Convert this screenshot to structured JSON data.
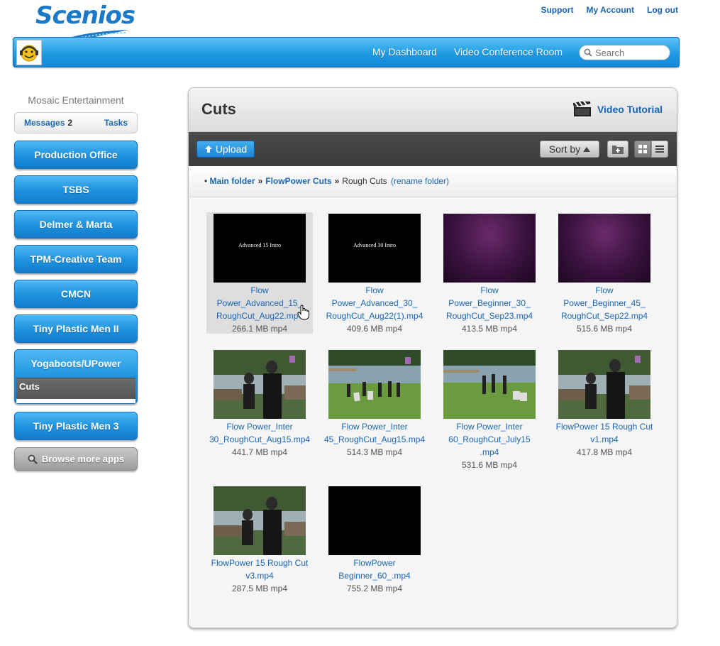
{
  "logo": {
    "text": "Scenios"
  },
  "toplinks": [
    "Support",
    "My Account",
    "Log out"
  ],
  "nav": [
    "My Dashboard",
    "Video Conference Room"
  ],
  "search": {
    "placeholder": "Search"
  },
  "sidebar": {
    "org": "Mosaic Entertainment",
    "tabs": {
      "messages": "Messages",
      "messages_count": "2",
      "tasks": "Tasks"
    },
    "items": [
      {
        "label": "Production Office"
      },
      {
        "label": "TSBS"
      },
      {
        "label": "Delmer & Marta"
      },
      {
        "label": "TPM-Creative Team"
      },
      {
        "label": "CMCN"
      },
      {
        "label": "Tiny Plastic Men II"
      },
      {
        "label": "Yogaboots/UPower",
        "sub": "Cuts"
      },
      {
        "label": "Tiny Plastic Men 3"
      }
    ],
    "browse": "Browse more apps"
  },
  "panel": {
    "title": "Cuts",
    "tutorial": "Video Tutorial",
    "upload": "Upload",
    "sortby": "Sort by",
    "breadcrumb": {
      "root": "Main folder",
      "mid": "FlowPower Cuts",
      "current": "Rough Cuts",
      "rename": "(rename folder)"
    }
  },
  "files": [
    {
      "name": "Flow Power_Advanced_15_RoughCut_Aug22.mp4",
      "line1": "Flow",
      "line2": "Power_Advanced_15_",
      "line3": "RoughCut_Aug22.mp4",
      "size": "266.1 MB mp4",
      "thumb": "black",
      "caption": "Advanced 15 Intro"
    },
    {
      "line1": "Flow",
      "line2": "Power_Advanced_30_",
      "line3": "RoughCut_Aug22(1).mp4",
      "size": "409.6 MB mp4",
      "thumb": "black",
      "caption": "Advanced 30 Intro"
    },
    {
      "line1": "Flow",
      "line2": "Power_Beginner_30_",
      "line3": "RoughCut_Sep23.mp4",
      "size": "413.5 MB mp4",
      "thumb": "purple"
    },
    {
      "line1": "Flow",
      "line2": "Power_Beginner_45_",
      "line3": "RoughCut_Sep22.mp4",
      "size": "515.6 MB mp4",
      "thumb": "purple"
    },
    {
      "line1": "Flow Power_Inter",
      "line2": "30_RoughCut_Aug15.mp4",
      "size": "441.7 MB mp4",
      "thumb": "pond"
    },
    {
      "line1": "Flow Power_Inter",
      "line2": "45_RoughCut_Aug15.mp4",
      "size": "514.3 MB mp4",
      "thumb": "dock"
    },
    {
      "line1": "Flow Power_Inter",
      "line2": "60_RoughCut_July15",
      "line3": ".mp4",
      "size": "531.6 MB mp4",
      "thumb": "dock"
    },
    {
      "line1": "FlowPower 15 Rough Cut",
      "line2": "v1.mp4",
      "size": "417.8 MB mp4",
      "thumb": "pond"
    },
    {
      "line1": "FlowPower 15 Rough Cut",
      "line2": "v3.mp4",
      "size": "287.5 MB mp4",
      "thumb": "pond"
    },
    {
      "line1": "FlowPower",
      "line2": "Beginner_60_.mp4",
      "size": "755.2 MB mp4",
      "thumb": "blank"
    }
  ],
  "colors": {
    "accent": "#1a66b5",
    "bar": "#1f9be3",
    "toolbar": "#3f3f3f"
  }
}
